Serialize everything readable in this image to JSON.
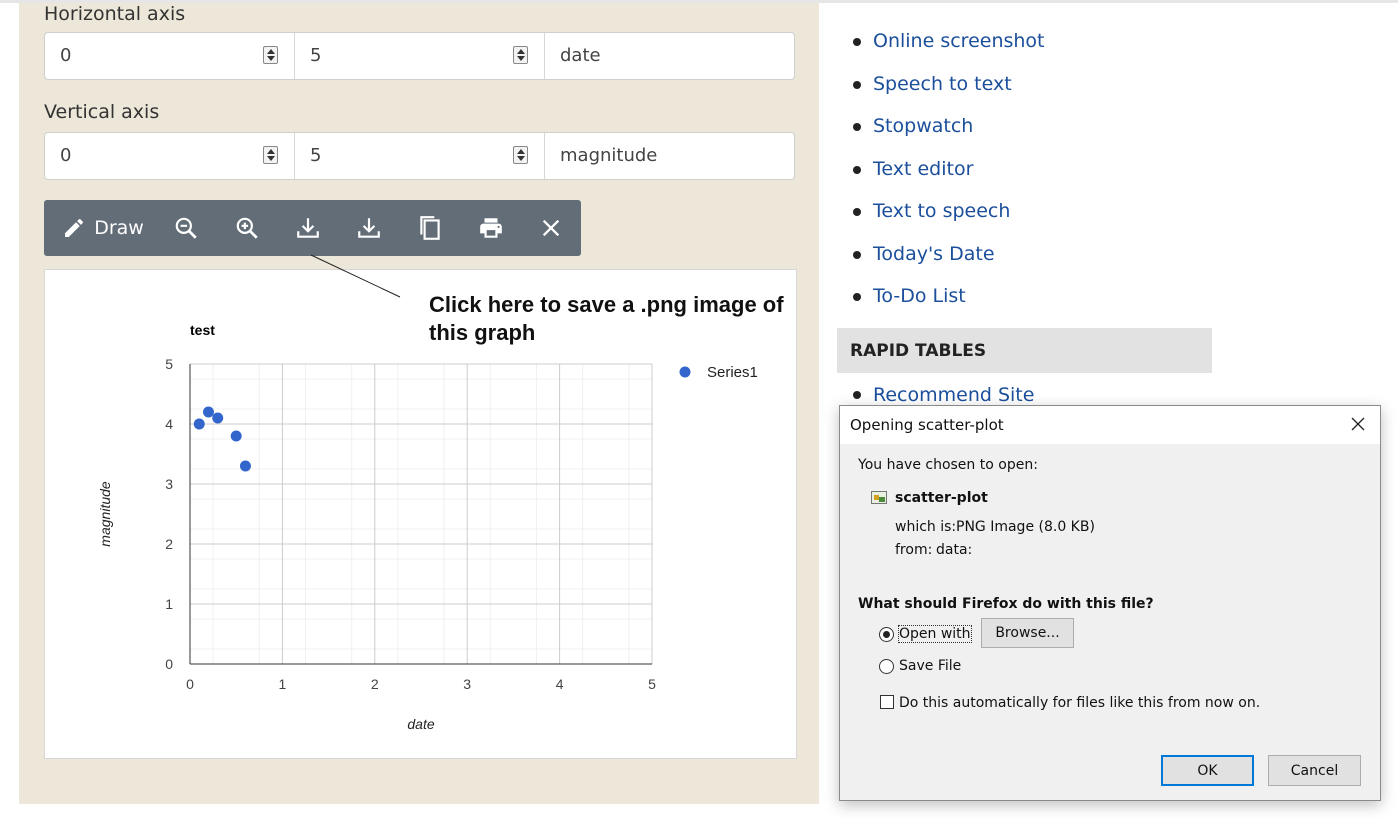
{
  "horizontal_axis": {
    "label": "Horizontal axis",
    "min": "0",
    "max": "5",
    "title": "date"
  },
  "vertical_axis": {
    "label": "Vertical axis",
    "min": "0",
    "max": "5",
    "title": "magnitude"
  },
  "toolbar": {
    "draw_label": "Draw",
    "icons": [
      "pencil-icon",
      "zoom-out-icon",
      "zoom-in-icon",
      "download-icon",
      "download-icon",
      "copy-icon",
      "print-icon",
      "close-icon"
    ]
  },
  "callout_text": "Click here to save a .png image of this graph",
  "chart_data": {
    "type": "scatter",
    "title": "test",
    "xlabel": "date",
    "ylabel": "magnitude",
    "xlim": [
      0,
      5
    ],
    "ylim": [
      0,
      5
    ],
    "x_ticks": [
      "0",
      "1",
      "2",
      "3",
      "4",
      "5"
    ],
    "y_ticks": [
      "0",
      "1",
      "2",
      "3",
      "4",
      "5"
    ],
    "grid": true,
    "legend": "right",
    "series": [
      {
        "name": "Series1",
        "color": "#3366cc",
        "points": [
          [
            0.1,
            4.0
          ],
          [
            0.2,
            4.2
          ],
          [
            0.3,
            4.1
          ],
          [
            0.5,
            3.8
          ],
          [
            0.6,
            3.3
          ]
        ]
      }
    ]
  },
  "sidebar": {
    "links": [
      "Online screenshot",
      "Speech to text",
      "Stopwatch",
      "Text editor",
      "Text to speech",
      "Today's Date",
      "To-Do List"
    ],
    "section_title": "RAPID TABLES",
    "recommend": "Recommend Site"
  },
  "dialog": {
    "title": "Opening scatter-plot",
    "intro": "You have chosen to open:",
    "filename": "scatter-plot",
    "which_is_label": "which is:",
    "which_is_value": "PNG Image (8.0 KB)",
    "from_label": "from:",
    "from_value": "data:",
    "question": "What should Firefox do with this file?",
    "open_with_label": "Open with",
    "browse_label": "Browse...",
    "save_file_label": "Save File",
    "auto_label": "Do this automatically for files like this from now on.",
    "ok_label": "OK",
    "cancel_label": "Cancel",
    "selected_option": "open_with",
    "auto_checked": false
  }
}
